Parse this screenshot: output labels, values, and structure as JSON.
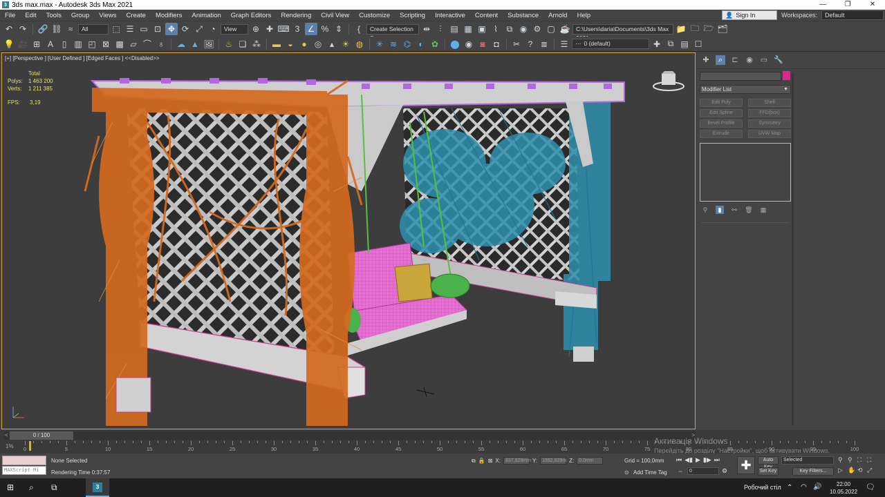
{
  "window": {
    "title": "3ds max.max - Autodesk 3ds Max 2021",
    "controls": [
      "—",
      "❐",
      "✕"
    ]
  },
  "menu": {
    "items": [
      "File",
      "Edit",
      "Tools",
      "Group",
      "Views",
      "Create",
      "Modifiers",
      "Animation",
      "Graph Editors",
      "Rendering",
      "Civil View",
      "Customize",
      "Scripting",
      "Interactive",
      "Content",
      "Substance",
      "Arnold",
      "Help"
    ],
    "sign_in": "Sign In",
    "workspaces_label": "Workspaces:",
    "workspace": "Default"
  },
  "toolbar": {
    "filter": "All",
    "coord_system": "View",
    "selection_set": "Create Selection Se",
    "project_path": "C:\\Users\\daria\\Documents\\3ds Max 2021",
    "layer": "0 (default)"
  },
  "viewport": {
    "label": "[+] [Perspective ] [User Defined ] [Edged Faces ]  <<Disabled>>",
    "stats_header": "Total",
    "polys_label": "Polys:",
    "polys_value": "1 463 200",
    "verts_label": "Verts:",
    "verts_value": "1 211 385",
    "fps_label": "FPS:",
    "fps_value": "3,19"
  },
  "command_panel": {
    "modifier_list": "Modifier List",
    "buttons": [
      "Edit Poly",
      "Shell",
      "Edit Spline",
      "FFD(box)",
      "Bevel Profile",
      "Symmetry",
      "Extrude",
      "UVW Map"
    ],
    "object_color": "#d62b88"
  },
  "timeline": {
    "frame_display": "0 / 100",
    "left_arrow": "<",
    "right_arrow": ">",
    "ticks": [
      "0",
      "5",
      "10",
      "15",
      "20",
      "25",
      "30",
      "35",
      "40",
      "45",
      "50",
      "55",
      "60",
      "65",
      "70",
      "75",
      "80",
      "85",
      "90",
      "95",
      "100"
    ],
    "percent": "1%"
  },
  "status": {
    "maxscript_hint": "MAXScript Mi",
    "selection": "None Selected",
    "render_time": "Rendering Time  0:37:57",
    "x_label": "X:",
    "x_value": "837,929mm",
    "y_label": "Y:",
    "y_value": "1992,829m",
    "z_label": "Z:",
    "z_value": "0,0mm",
    "grid": "Grid = 100,0mm",
    "add_time_tag": "Add Time Tag",
    "frame": "0",
    "auto_key": "Auto Key",
    "set_key": "Set Key",
    "selected": "Selected",
    "key_filters": "Key Filters..."
  },
  "activation": {
    "title": "Активація Windows",
    "subtitle": "Перейдіть до розділу \"Настройки\", щоб активувати Windows."
  },
  "taskbar": {
    "desktop": "Робочий стіл",
    "time": "22:00",
    "date": "10.05.2022"
  }
}
